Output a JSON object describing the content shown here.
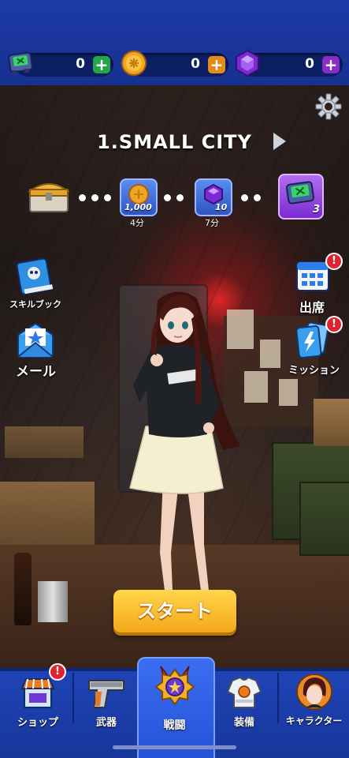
{
  "resources": [
    {
      "name": "device-currency",
      "value": "0",
      "plus": "+",
      "plus_color": "#23a64a"
    },
    {
      "name": "gold-coin",
      "value": "0",
      "plus": "+",
      "plus_color": "#e48a1a"
    },
    {
      "name": "purple-gem",
      "value": "0",
      "plus": "+",
      "plus_color": "#8a2bc7"
    }
  ],
  "stage": {
    "title": "1.SMALL CITY"
  },
  "rewards": [
    {
      "icon": "treasure-chest-icon",
      "amount": "",
      "time": ""
    },
    {
      "icon": "gold-coin-icon",
      "amount": "1,000",
      "time": "4分"
    },
    {
      "icon": "purple-gem-icon",
      "amount": "10",
      "time": "7分"
    },
    {
      "icon": "device-icon",
      "amount": "3",
      "time": ""
    }
  ],
  "side_left": [
    {
      "icon": "skill-book-icon",
      "label": "スキルブック"
    },
    {
      "icon": "mail-icon",
      "label": "メール"
    }
  ],
  "side_right": [
    {
      "icon": "calendar-icon",
      "label": "出席",
      "badge": "!"
    },
    {
      "icon": "mission-cards-icon",
      "label": "ミッション",
      "badge": "!"
    }
  ],
  "start_button": {
    "label": "スタート"
  },
  "nav": {
    "tabs": [
      {
        "icon": "shop-icon",
        "label": "ショップ",
        "badge": "!"
      },
      {
        "icon": "pistol-icon",
        "label": "武器"
      },
      {
        "icon": "battle-medal-icon",
        "label": "戦闘",
        "active": true
      },
      {
        "icon": "armor-icon",
        "label": "装備"
      },
      {
        "icon": "character-portrait-icon",
        "label": "キャラクター"
      }
    ]
  },
  "colors": {
    "header": "#1e3aa8",
    "nav": "#1f44b7",
    "accent_yellow": "#ffd64a",
    "badge_red": "#e0242f"
  }
}
